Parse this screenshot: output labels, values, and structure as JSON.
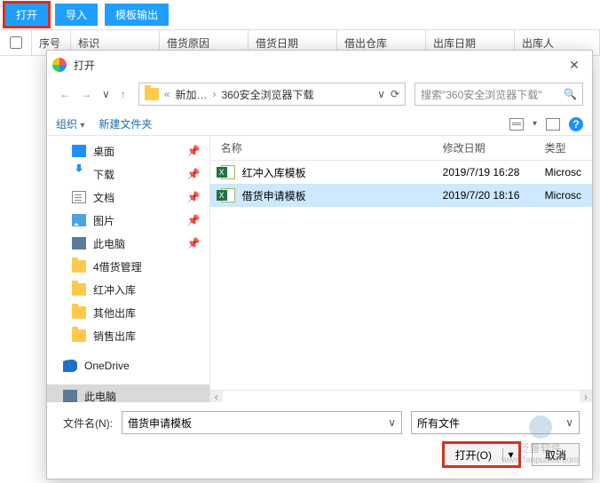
{
  "bg": {
    "toolbar": {
      "open": "打开",
      "import": "导入",
      "template_export": "模板输出"
    },
    "columns": [
      "序号",
      "标识",
      "借货原因",
      "借货日期",
      "借出仓库",
      "出库日期",
      "出库人"
    ]
  },
  "dialog": {
    "title": "打开",
    "nav": {
      "back": "←",
      "fwd": "→",
      "up": "↑"
    },
    "breadcrumb": {
      "sep1": "«",
      "part1": "新加…",
      "sep2": "›",
      "part2": "360安全浏览器下载",
      "drop": "∨",
      "refresh": "⟳"
    },
    "search": {
      "placeholder": "搜索\"360安全浏览器下载\"",
      "icon": "🔍"
    },
    "toolbar": {
      "org": "组织",
      "newfolder": "新建文件夹"
    },
    "sidebar": [
      {
        "icon": "monitor",
        "label": "桌面",
        "pin": true
      },
      {
        "icon": "arrowdn",
        "label": "下载",
        "pin": true
      },
      {
        "icon": "doc",
        "label": "文档",
        "pin": true
      },
      {
        "icon": "pic",
        "label": "图片",
        "pin": true
      },
      {
        "icon": "pc",
        "label": "此电脑",
        "pin": true
      },
      {
        "icon": "fold",
        "label": "4借货管理"
      },
      {
        "icon": "fold",
        "label": "红冲入库"
      },
      {
        "icon": "fold",
        "label": "其他出库"
      },
      {
        "icon": "fold",
        "label": "销售出库"
      },
      {
        "icon": "cloud",
        "label": "OneDrive",
        "spacer": true
      },
      {
        "icon": "pc",
        "label": "此电脑",
        "selected": true
      }
    ],
    "fileHeaders": {
      "name": "名称",
      "date": "修改日期",
      "type": "类型"
    },
    "files": [
      {
        "name": "红冲入库模板",
        "date": "2019/7/19 16:28",
        "type": "Microsc"
      },
      {
        "name": "借货申请模板",
        "date": "2019/7/20 18:16",
        "type": "Microsc",
        "selected": true
      }
    ],
    "footer": {
      "filename_label": "文件名(N):",
      "filename_value": "借货申请模板",
      "filter": "所有文件",
      "open": "打开(O)",
      "cancel": "取消"
    }
  },
  "watermark": {
    "text": "泛普软件",
    "url": "www.fanpusoft.com"
  }
}
